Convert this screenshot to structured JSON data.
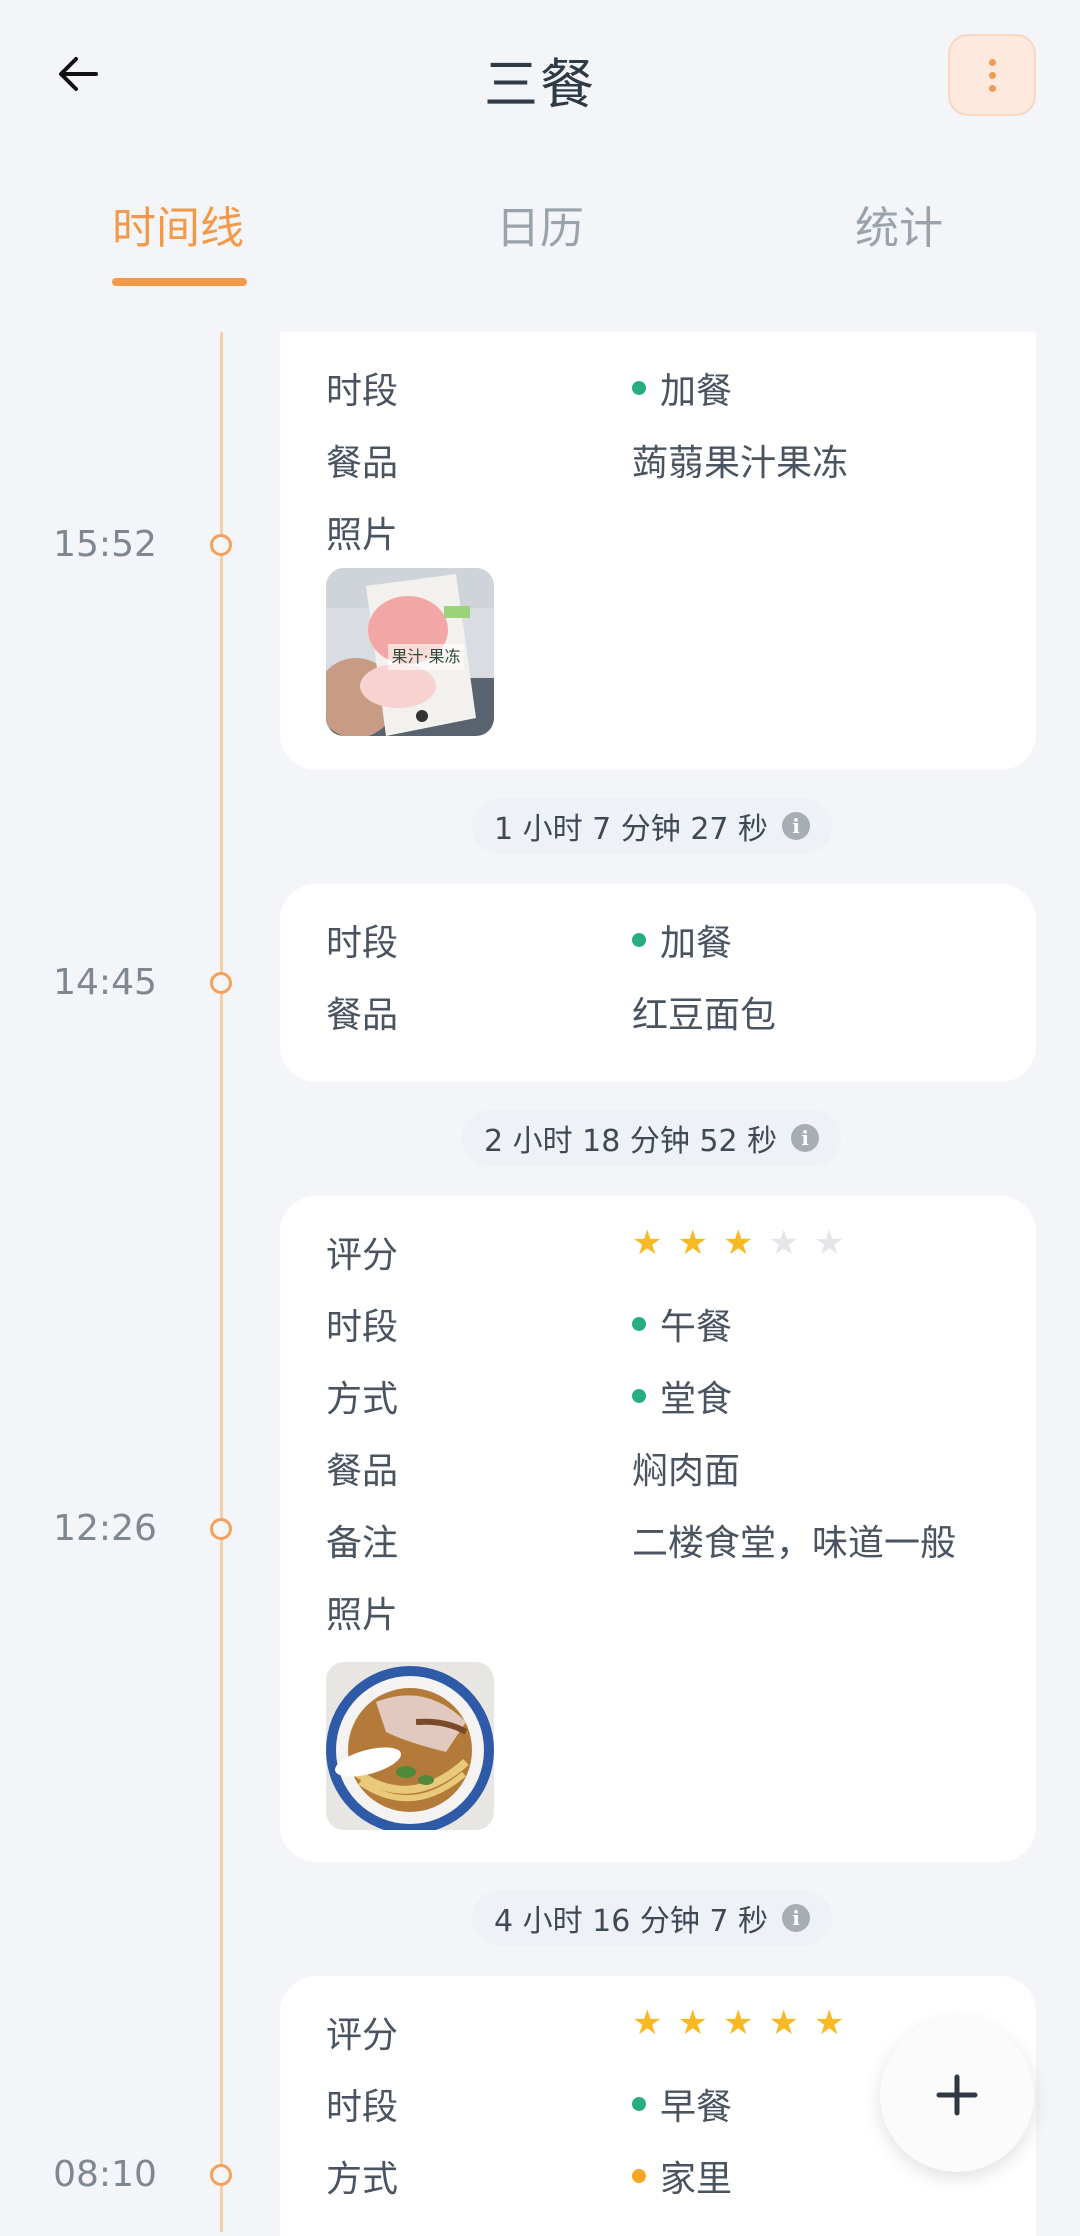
{
  "header": {
    "title": "三餐"
  },
  "tabs": [
    {
      "label": "时间线",
      "active": true
    },
    {
      "label": "日历",
      "active": false
    },
    {
      "label": "统计",
      "active": false
    }
  ],
  "entries": [
    {
      "time": "15:52",
      "rows": [
        {
          "label": "时段",
          "value": "加餐",
          "dot_color": "#27ae7f"
        },
        {
          "label": "餐品",
          "value": "蒟蒻果汁果冻"
        },
        {
          "label": "照片"
        }
      ]
    },
    {
      "time": "14:45",
      "rows": [
        {
          "label": "时段",
          "value": "加餐",
          "dot_color": "#27ae7f"
        },
        {
          "label": "餐品",
          "value": "红豆面包"
        }
      ]
    },
    {
      "time": "12:26",
      "rating": 3,
      "rows": [
        {
          "label": "评分"
        },
        {
          "label": "时段",
          "value": "午餐",
          "dot_color": "#27ae7f"
        },
        {
          "label": "方式",
          "value": "堂食",
          "dot_color": "#27ae7f"
        },
        {
          "label": "餐品",
          "value": "焖肉面"
        },
        {
          "label": "备注",
          "value": "二楼食堂，味道一般"
        },
        {
          "label": "照片"
        }
      ]
    },
    {
      "time": "08:10",
      "rating": 5,
      "rows": [
        {
          "label": "评分"
        },
        {
          "label": "时段",
          "value": "早餐",
          "dot_color": "#27ae7f"
        },
        {
          "label": "方式",
          "value": "家里",
          "dot_color": "#f5a623"
        }
      ]
    }
  ],
  "gaps": [
    "1 小时 7 分钟 27 秒",
    "2 小时 18 分钟 52 秒",
    "4 小时 16 分钟 7 秒"
  ],
  "photo1_text": "果汁·果冻",
  "colors": {
    "accent": "#f39a4a",
    "green": "#27ae7f",
    "orange_dot": "#f5a623",
    "star": "#f7b924"
  }
}
